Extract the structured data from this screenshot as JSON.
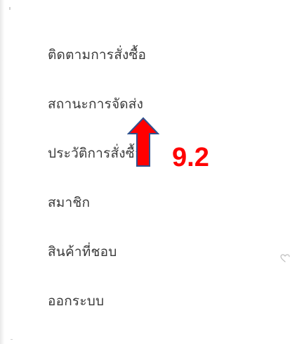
{
  "menu": {
    "items": [
      {
        "label": "ติดตามการสั่งซื้อ"
      },
      {
        "label": "สถานะการจัดส่ง"
      },
      {
        "label": "ประวัติการสั่งซื้อ"
      },
      {
        "label": "สมาชิก"
      },
      {
        "label": "สินค้าที่ชอบ"
      },
      {
        "label": "ออกระบบ"
      }
    ]
  },
  "annotation": {
    "step_label": "9.2",
    "arrow_color": "#ff0000",
    "arrow_outline": "#2f528f"
  },
  "icons": {
    "arrow": "up-arrow-icon",
    "heart": "heart-outline-icon"
  },
  "colors": {
    "menu_text": "#3a3a3a",
    "annotation_red": "#ff0000"
  }
}
